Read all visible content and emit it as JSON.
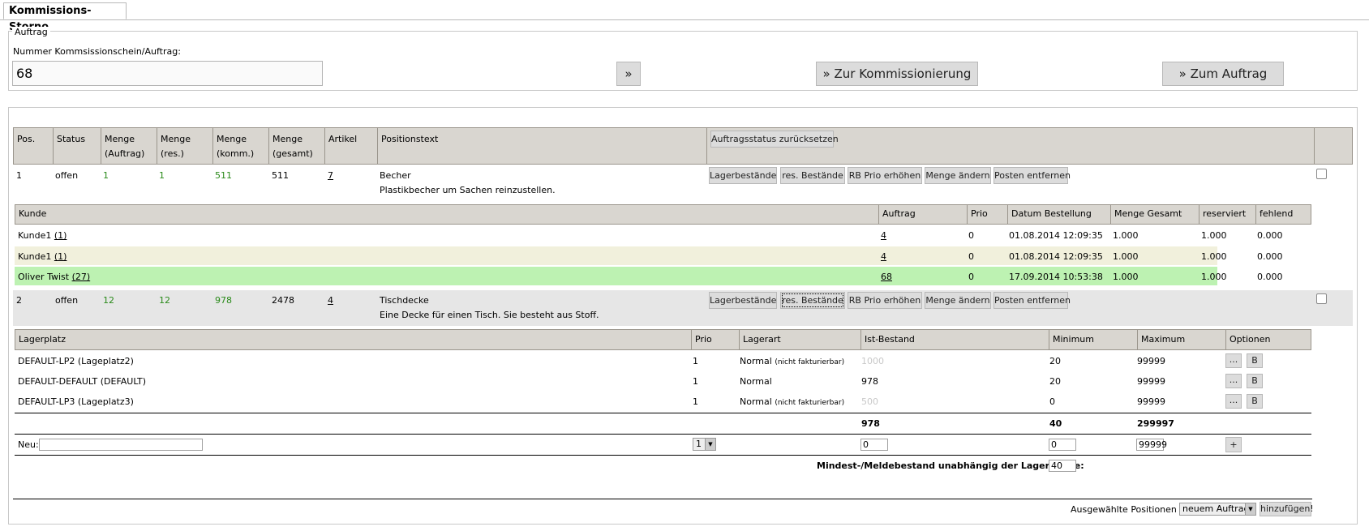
{
  "tab": {
    "label": "Kommissions-Storno"
  },
  "auftrag": {
    "legend": "Auftrag",
    "field_label": "Nummer Kommsissionschein/Auftrag:",
    "field_value": "68",
    "go_label": "»",
    "kommissionierung_label": "» Zur Kommissionierung",
    "zum_auftrag_label": "» Zum Auftrag"
  },
  "main_table": {
    "headers": {
      "pos": "Pos.",
      "status": "Status",
      "menge_auftrag_1": "Menge",
      "menge_auftrag_2": "(Auftrag)",
      "menge_res_1": "Menge",
      "menge_res_2": "(res.)",
      "menge_komm_1": "Menge",
      "menge_komm_2": "(komm.)",
      "menge_gesamt_1": "Menge",
      "menge_gesamt_2": "(gesamt)",
      "artikel": "Artikel",
      "positionstext": "Positionstext",
      "reset_button": "Auftragsstatus zurücksetzen"
    },
    "action_buttons": {
      "lagerbestaende": "Lagerbestände",
      "res_bestaende": "res. Bestände",
      "rb_prio": "RB Prio erhöhen",
      "menge_aendern": "Menge ändern",
      "posten_entfernen": "Posten entfernen"
    },
    "positions": [
      {
        "pos": "1",
        "status": "offen",
        "menge_auftrag": "1",
        "menge_res": "1",
        "menge_komm": "511",
        "menge_gesamt": "511",
        "artikel": "7",
        "title": "Becher",
        "text": "Plastikbecher um Sachen reinzustellen."
      },
      {
        "pos": "2",
        "status": "offen",
        "menge_auftrag": "12",
        "menge_res": "12",
        "menge_komm": "978",
        "menge_gesamt": "2478",
        "artikel": "4",
        "title": "Tischdecke",
        "text": "Eine Decke für einen Tisch. Sie besteht aus Stoff."
      }
    ]
  },
  "kunde_table": {
    "headers": {
      "kunde": "Kunde",
      "auftrag": "Auftrag",
      "prio": "Prio",
      "datum": "Datum Bestellung",
      "menge_gesamt": "Menge Gesamt",
      "reserviert": "reserviert",
      "fehlend": "fehlend"
    },
    "rows": [
      {
        "kunde": "Kunde1",
        "kunde_id": "(1)",
        "auftrag": "4",
        "prio": "0",
        "datum": "01.08.2014 12:09:35",
        "menge_gesamt": "1.000",
        "reserviert": "1.000",
        "fehlend": "0.000"
      },
      {
        "kunde": "Kunde1",
        "kunde_id": "(1)",
        "auftrag": "4",
        "prio": "0",
        "datum": "01.08.2014 12:09:35",
        "menge_gesamt": "1.000",
        "reserviert": "1.000",
        "fehlend": "0.000"
      },
      {
        "kunde": "Oliver Twist",
        "kunde_id": "(27)",
        "auftrag": "68",
        "prio": "0",
        "datum": "17.09.2014 10:53:38",
        "menge_gesamt": "1.000",
        "reserviert": "1.000",
        "fehlend": "0.000"
      }
    ],
    "row_colors": [
      "#ffffff",
      "#f1f0dc",
      "#bdf2b2"
    ]
  },
  "lager_table": {
    "headers": {
      "lagerplatz": "Lagerplatz",
      "prio": "Prio",
      "lagerart": "Lagerart",
      "ist_bestand": "Ist-Bestand",
      "minimum": "Minimum",
      "maximum": "Maximum",
      "optionen": "Optionen"
    },
    "rows": [
      {
        "lagerplatz": "DEFAULT-LP2 (Lageplatz2)",
        "prio": "1",
        "lagerart": "Normal",
        "lagerart_note": "(nicht fakturierbar)",
        "ist": "1000",
        "min": "20",
        "max": "99999"
      },
      {
        "lagerplatz": "DEFAULT-DEFAULT (DEFAULT)",
        "prio": "1",
        "lagerart": "Normal",
        "lagerart_note": "",
        "ist": "978",
        "min": "20",
        "max": "99999"
      },
      {
        "lagerplatz": "DEFAULT-LP3 (Lageplatz3)",
        "prio": "1",
        "lagerart": "Normal",
        "lagerart_note": "(nicht fakturierbar)",
        "ist": "500",
        "min": "0",
        "max": "99999"
      }
    ],
    "options_dots": "...",
    "options_b": "B",
    "totals": {
      "ist": "978",
      "min": "40",
      "max": "299997"
    },
    "neu": {
      "label": "Neu:",
      "prio_value": "1",
      "ist_value": "0",
      "min_value": "0",
      "max_value": "99999",
      "add_label": "+"
    },
    "mindest_label": "Mindest-/Meldebestand unabhängig der Lagerplätze:",
    "mindest_value": "40"
  },
  "footer": {
    "label": "Ausgewählte Positionen zu",
    "select_value": "neuem Auftrag",
    "submit_label": "hinzufügen!"
  }
}
